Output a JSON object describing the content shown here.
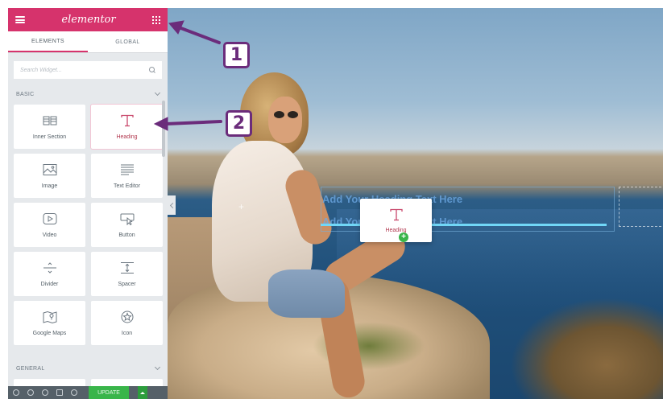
{
  "panel": {
    "logo": "elementor",
    "tabs": [
      "ELEMENTS",
      "GLOBAL"
    ],
    "search_placeholder": "Search Widget...",
    "sections": {
      "basic": "BASIC",
      "general": "GENERAL"
    },
    "widgets": [
      {
        "label": "Inner Section",
        "icon": "columns-icon"
      },
      {
        "label": "Heading",
        "icon": "heading-t-icon"
      },
      {
        "label": "Image",
        "icon": "image-icon"
      },
      {
        "label": "Text Editor",
        "icon": "text-lines-icon"
      },
      {
        "label": "Video",
        "icon": "video-play-icon"
      },
      {
        "label": "Button",
        "icon": "button-cursor-icon"
      },
      {
        "label": "Divider",
        "icon": "divider-icon"
      },
      {
        "label": "Spacer",
        "icon": "spacer-icon"
      },
      {
        "label": "Google Maps",
        "icon": "map-pin-icon"
      },
      {
        "label": "Icon",
        "icon": "star-circle-icon"
      }
    ],
    "update_label": "UPDATE"
  },
  "canvas": {
    "heading_line1": "Add Your Heading Text Here",
    "heading_line2": "Add Your Heading Text Here",
    "drag_label": "Heading"
  },
  "annotations": {
    "badge1": "1",
    "badge2": "2",
    "color": "#6b2c7b"
  },
  "colors": {
    "accent": "#d6336c",
    "update": "#39b54a",
    "drop_line": "#71d7f7"
  }
}
